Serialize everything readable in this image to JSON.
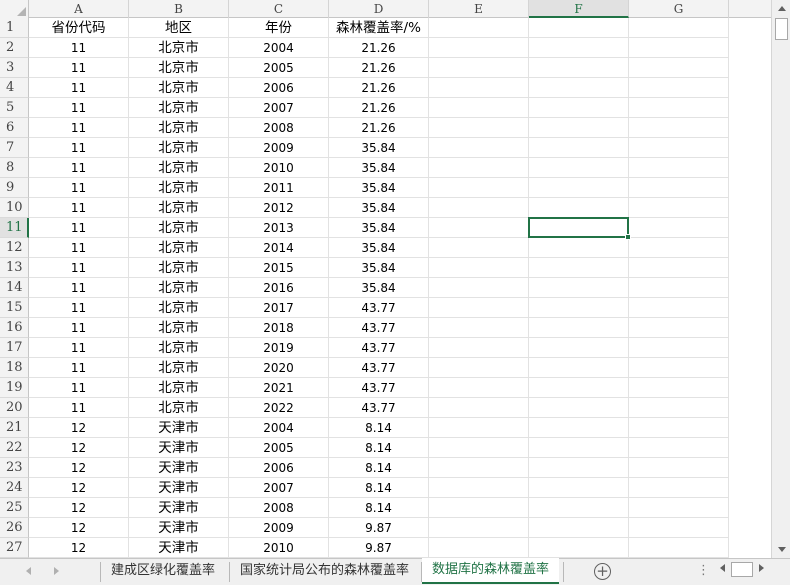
{
  "columns": [
    {
      "label": "A"
    },
    {
      "label": "B"
    },
    {
      "label": "C"
    },
    {
      "label": "D"
    },
    {
      "label": "E"
    },
    {
      "label": "F",
      "active": true
    },
    {
      "label": "G"
    }
  ],
  "rows": [
    {
      "n": "1",
      "cells": [
        "省份代码",
        "地区",
        "年份",
        "森林覆盖率/%"
      ]
    },
    {
      "n": "2",
      "cells": [
        "11",
        "北京市",
        "2004",
        "21.26"
      ]
    },
    {
      "n": "3",
      "cells": [
        "11",
        "北京市",
        "2005",
        "21.26"
      ]
    },
    {
      "n": "4",
      "cells": [
        "11",
        "北京市",
        "2006",
        "21.26"
      ]
    },
    {
      "n": "5",
      "cells": [
        "11",
        "北京市",
        "2007",
        "21.26"
      ]
    },
    {
      "n": "6",
      "cells": [
        "11",
        "北京市",
        "2008",
        "21.26"
      ]
    },
    {
      "n": "7",
      "cells": [
        "11",
        "北京市",
        "2009",
        "35.84"
      ]
    },
    {
      "n": "8",
      "cells": [
        "11",
        "北京市",
        "2010",
        "35.84"
      ]
    },
    {
      "n": "9",
      "cells": [
        "11",
        "北京市",
        "2011",
        "35.84"
      ]
    },
    {
      "n": "10",
      "cells": [
        "11",
        "北京市",
        "2012",
        "35.84"
      ]
    },
    {
      "n": "11",
      "cells": [
        "11",
        "北京市",
        "2013",
        "35.84"
      ],
      "active": true
    },
    {
      "n": "12",
      "cells": [
        "11",
        "北京市",
        "2014",
        "35.84"
      ]
    },
    {
      "n": "13",
      "cells": [
        "11",
        "北京市",
        "2015",
        "35.84"
      ]
    },
    {
      "n": "14",
      "cells": [
        "11",
        "北京市",
        "2016",
        "35.84"
      ]
    },
    {
      "n": "15",
      "cells": [
        "11",
        "北京市",
        "2017",
        "43.77"
      ]
    },
    {
      "n": "16",
      "cells": [
        "11",
        "北京市",
        "2018",
        "43.77"
      ]
    },
    {
      "n": "17",
      "cells": [
        "11",
        "北京市",
        "2019",
        "43.77"
      ]
    },
    {
      "n": "18",
      "cells": [
        "11",
        "北京市",
        "2020",
        "43.77"
      ]
    },
    {
      "n": "19",
      "cells": [
        "11",
        "北京市",
        "2021",
        "43.77"
      ]
    },
    {
      "n": "20",
      "cells": [
        "11",
        "北京市",
        "2022",
        "43.77"
      ]
    },
    {
      "n": "21",
      "cells": [
        "12",
        "天津市",
        "2004",
        "8.14"
      ]
    },
    {
      "n": "22",
      "cells": [
        "12",
        "天津市",
        "2005",
        "8.14"
      ]
    },
    {
      "n": "23",
      "cells": [
        "12",
        "天津市",
        "2006",
        "8.14"
      ]
    },
    {
      "n": "24",
      "cells": [
        "12",
        "天津市",
        "2007",
        "8.14"
      ]
    },
    {
      "n": "25",
      "cells": [
        "12",
        "天津市",
        "2008",
        "8.14"
      ]
    },
    {
      "n": "26",
      "cells": [
        "12",
        "天津市",
        "2009",
        "9.87"
      ]
    },
    {
      "n": "27",
      "cells": [
        "12",
        "天津市",
        "2010",
        "9.87"
      ]
    }
  ],
  "selected_cell": "F11",
  "sheet_tabs": [
    {
      "label": "建成区绿化覆盖率"
    },
    {
      "label": "国家统计局公布的森林覆盖率"
    },
    {
      "label": "数据库的森林覆盖率",
      "active": true
    }
  ],
  "tabbar": {
    "add_label": "+",
    "dots_label": "⋮"
  },
  "colors": {
    "accent": "#217346",
    "header_bg": "#f3f3f3",
    "gridline": "#e2e2e2"
  }
}
